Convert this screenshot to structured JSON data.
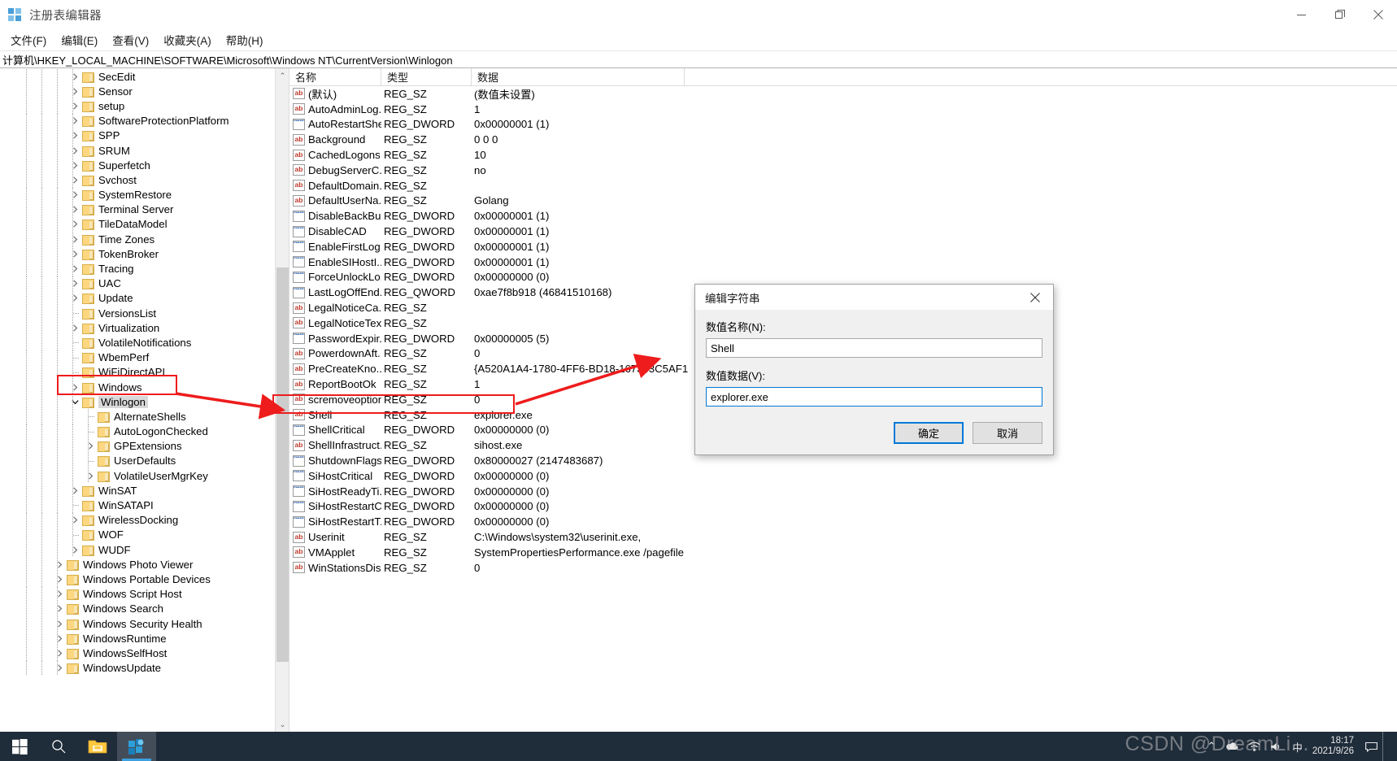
{
  "window": {
    "title": "注册表编辑器",
    "minimize_label": "—",
    "maximize_label": "❐",
    "close_label": "✕"
  },
  "menu": {
    "items": [
      {
        "label": "文件(F)"
      },
      {
        "label": "编辑(E)"
      },
      {
        "label": "查看(V)"
      },
      {
        "label": "收藏夹(A)"
      },
      {
        "label": "帮助(H)"
      }
    ]
  },
  "address": {
    "path": "计算机\\HKEY_LOCAL_MACHINE\\SOFTWARE\\Microsoft\\Windows NT\\CurrentVersion\\Winlogon"
  },
  "tree": {
    "scroll_up_icon": "⌃",
    "scroll_down_icon": "⌄",
    "nodes": [
      {
        "label": "SecEdit",
        "depth": 4,
        "expandable": true,
        "expanded": false,
        "selected": false
      },
      {
        "label": "Sensor",
        "depth": 4,
        "expandable": true,
        "expanded": false,
        "selected": false
      },
      {
        "label": "setup",
        "depth": 4,
        "expandable": true,
        "expanded": false,
        "selected": false
      },
      {
        "label": "SoftwareProtectionPlatform",
        "depth": 4,
        "expandable": true,
        "expanded": false,
        "selected": false
      },
      {
        "label": "SPP",
        "depth": 4,
        "expandable": true,
        "expanded": false,
        "selected": false
      },
      {
        "label": "SRUM",
        "depth": 4,
        "expandable": true,
        "expanded": false,
        "selected": false
      },
      {
        "label": "Superfetch",
        "depth": 4,
        "expandable": true,
        "expanded": false,
        "selected": false
      },
      {
        "label": "Svchost",
        "depth": 4,
        "expandable": true,
        "expanded": false,
        "selected": false
      },
      {
        "label": "SystemRestore",
        "depth": 4,
        "expandable": true,
        "expanded": false,
        "selected": false
      },
      {
        "label": "Terminal Server",
        "depth": 4,
        "expandable": true,
        "expanded": false,
        "selected": false
      },
      {
        "label": "TileDataModel",
        "depth": 4,
        "expandable": true,
        "expanded": false,
        "selected": false
      },
      {
        "label": "Time Zones",
        "depth": 4,
        "expandable": true,
        "expanded": false,
        "selected": false
      },
      {
        "label": "TokenBroker",
        "depth": 4,
        "expandable": true,
        "expanded": false,
        "selected": false
      },
      {
        "label": "Tracing",
        "depth": 4,
        "expandable": true,
        "expanded": false,
        "selected": false
      },
      {
        "label": "UAC",
        "depth": 4,
        "expandable": true,
        "expanded": false,
        "selected": false
      },
      {
        "label": "Update",
        "depth": 4,
        "expandable": true,
        "expanded": false,
        "selected": false
      },
      {
        "label": "VersionsList",
        "depth": 4,
        "expandable": false,
        "expanded": false,
        "selected": false
      },
      {
        "label": "Virtualization",
        "depth": 4,
        "expandable": true,
        "expanded": false,
        "selected": false
      },
      {
        "label": "VolatileNotifications",
        "depth": 4,
        "expandable": false,
        "expanded": false,
        "selected": false
      },
      {
        "label": "WbemPerf",
        "depth": 4,
        "expandable": false,
        "expanded": false,
        "selected": false
      },
      {
        "label": "WiFiDirectAPI",
        "depth": 4,
        "expandable": false,
        "expanded": false,
        "selected": false
      },
      {
        "label": "Windows",
        "depth": 4,
        "expandable": true,
        "expanded": false,
        "selected": false
      },
      {
        "label": "Winlogon",
        "depth": 4,
        "expandable": true,
        "expanded": true,
        "selected": true
      },
      {
        "label": "AlternateShells",
        "depth": 5,
        "expandable": false,
        "expanded": false,
        "selected": false
      },
      {
        "label": "AutoLogonChecked",
        "depth": 5,
        "expandable": false,
        "expanded": false,
        "selected": false
      },
      {
        "label": "GPExtensions",
        "depth": 5,
        "expandable": true,
        "expanded": false,
        "selected": false
      },
      {
        "label": "UserDefaults",
        "depth": 5,
        "expandable": false,
        "expanded": false,
        "selected": false
      },
      {
        "label": "VolatileUserMgrKey",
        "depth": 5,
        "expandable": true,
        "expanded": false,
        "selected": false
      },
      {
        "label": "WinSAT",
        "depth": 4,
        "expandable": true,
        "expanded": false,
        "selected": false
      },
      {
        "label": "WinSATAPI",
        "depth": 4,
        "expandable": false,
        "expanded": false,
        "selected": false
      },
      {
        "label": "WirelessDocking",
        "depth": 4,
        "expandable": true,
        "expanded": false,
        "selected": false
      },
      {
        "label": "WOF",
        "depth": 4,
        "expandable": false,
        "expanded": false,
        "selected": false
      },
      {
        "label": "WUDF",
        "depth": 4,
        "expandable": true,
        "expanded": false,
        "selected": false
      },
      {
        "label": "Windows Photo Viewer",
        "depth": 3,
        "expandable": true,
        "expanded": false,
        "selected": false
      },
      {
        "label": "Windows Portable Devices",
        "depth": 3,
        "expandable": true,
        "expanded": false,
        "selected": false
      },
      {
        "label": "Windows Script Host",
        "depth": 3,
        "expandable": true,
        "expanded": false,
        "selected": false
      },
      {
        "label": "Windows Search",
        "depth": 3,
        "expandable": true,
        "expanded": false,
        "selected": false
      },
      {
        "label": "Windows Security Health",
        "depth": 3,
        "expandable": true,
        "expanded": false,
        "selected": false
      },
      {
        "label": "WindowsRuntime",
        "depth": 3,
        "expandable": true,
        "expanded": false,
        "selected": false
      },
      {
        "label": "WindowsSelfHost",
        "depth": 3,
        "expandable": true,
        "expanded": false,
        "selected": false
      },
      {
        "label": "WindowsUpdate",
        "depth": 3,
        "expandable": true,
        "expanded": false,
        "selected": false
      }
    ]
  },
  "values": {
    "columns": {
      "name": "名称",
      "type": "类型",
      "data": "数据"
    },
    "rows": [
      {
        "icon": "string-value-icon",
        "name": "(默认)",
        "type": "REG_SZ",
        "data": "(数值未设置)",
        "highlight": false
      },
      {
        "icon": "string-value-icon",
        "name": "AutoAdminLog...",
        "type": "REG_SZ",
        "data": "1",
        "highlight": false
      },
      {
        "icon": "dword-value-icon",
        "name": "AutoRestartShell",
        "type": "REG_DWORD",
        "data": "0x00000001 (1)",
        "highlight": false
      },
      {
        "icon": "string-value-icon",
        "name": "Background",
        "type": "REG_SZ",
        "data": "0 0 0",
        "highlight": false
      },
      {
        "icon": "string-value-icon",
        "name": "CachedLogons...",
        "type": "REG_SZ",
        "data": "10",
        "highlight": false
      },
      {
        "icon": "string-value-icon",
        "name": "DebugServerC...",
        "type": "REG_SZ",
        "data": "no",
        "highlight": false
      },
      {
        "icon": "string-value-icon",
        "name": "DefaultDomain...",
        "type": "REG_SZ",
        "data": "",
        "highlight": false
      },
      {
        "icon": "string-value-icon",
        "name": "DefaultUserNa...",
        "type": "REG_SZ",
        "data": "Golang",
        "highlight": false
      },
      {
        "icon": "dword-value-icon",
        "name": "DisableBackBu...",
        "type": "REG_DWORD",
        "data": "0x00000001 (1)",
        "highlight": false
      },
      {
        "icon": "dword-value-icon",
        "name": "DisableCAD",
        "type": "REG_DWORD",
        "data": "0x00000001 (1)",
        "highlight": false
      },
      {
        "icon": "dword-value-icon",
        "name": "EnableFirstLog...",
        "type": "REG_DWORD",
        "data": "0x00000001 (1)",
        "highlight": false
      },
      {
        "icon": "dword-value-icon",
        "name": "EnableSIHostI...",
        "type": "REG_DWORD",
        "data": "0x00000001 (1)",
        "highlight": false
      },
      {
        "icon": "dword-value-icon",
        "name": "ForceUnlockLo...",
        "type": "REG_DWORD",
        "data": "0x00000000 (0)",
        "highlight": false
      },
      {
        "icon": "dword-value-icon",
        "name": "LastLogOffEnd...",
        "type": "REG_QWORD",
        "data": "0xae7f8b918 (46841510168)",
        "highlight": false
      },
      {
        "icon": "string-value-icon",
        "name": "LegalNoticeCa...",
        "type": "REG_SZ",
        "data": "",
        "highlight": false
      },
      {
        "icon": "string-value-icon",
        "name": "LegalNoticeText",
        "type": "REG_SZ",
        "data": "",
        "highlight": false
      },
      {
        "icon": "dword-value-icon",
        "name": "PasswordExpir...",
        "type": "REG_DWORD",
        "data": "0x00000005 (5)",
        "highlight": false
      },
      {
        "icon": "string-value-icon",
        "name": "PowerdownAft...",
        "type": "REG_SZ",
        "data": "0",
        "highlight": false
      },
      {
        "icon": "string-value-icon",
        "name": "PreCreateKno...",
        "type": "REG_SZ",
        "data": "{A520A1A4-1780-4FF6-BD18-167343C5AF1",
        "highlight": false
      },
      {
        "icon": "string-value-icon",
        "name": "ReportBootOk",
        "type": "REG_SZ",
        "data": "1",
        "highlight": false
      },
      {
        "icon": "string-value-icon",
        "name": "scremoveoption",
        "type": "REG_SZ",
        "data": "0",
        "highlight": false
      },
      {
        "icon": "string-value-icon",
        "name": "Shell",
        "type": "REG_SZ",
        "data": "explorer.exe",
        "highlight": true
      },
      {
        "icon": "dword-value-icon",
        "name": "ShellCritical",
        "type": "REG_DWORD",
        "data": "0x00000000 (0)",
        "highlight": false
      },
      {
        "icon": "string-value-icon",
        "name": "ShellInfrastruct...",
        "type": "REG_SZ",
        "data": "sihost.exe",
        "highlight": false
      },
      {
        "icon": "dword-value-icon",
        "name": "ShutdownFlags",
        "type": "REG_DWORD",
        "data": "0x80000027 (2147483687)",
        "highlight": false
      },
      {
        "icon": "dword-value-icon",
        "name": "SiHostCritical",
        "type": "REG_DWORD",
        "data": "0x00000000 (0)",
        "highlight": false
      },
      {
        "icon": "dword-value-icon",
        "name": "SiHostReadyTi...",
        "type": "REG_DWORD",
        "data": "0x00000000 (0)",
        "highlight": false
      },
      {
        "icon": "dword-value-icon",
        "name": "SiHostRestartC...",
        "type": "REG_DWORD",
        "data": "0x00000000 (0)",
        "highlight": false
      },
      {
        "icon": "dword-value-icon",
        "name": "SiHostRestartT...",
        "type": "REG_DWORD",
        "data": "0x00000000 (0)",
        "highlight": false
      },
      {
        "icon": "string-value-icon",
        "name": "Userinit",
        "type": "REG_SZ",
        "data": "C:\\Windows\\system32\\userinit.exe,",
        "highlight": false
      },
      {
        "icon": "string-value-icon",
        "name": "VMApplet",
        "type": "REG_SZ",
        "data": "SystemPropertiesPerformance.exe /pagefile",
        "highlight": false
      },
      {
        "icon": "string-value-icon",
        "name": "WinStationsDis...",
        "type": "REG_SZ",
        "data": "0",
        "highlight": false
      }
    ]
  },
  "dialog": {
    "title": "编辑字符串",
    "close_label": "✕",
    "name_label": "数值名称(N):",
    "name_value": "Shell",
    "data_label": "数值数据(V):",
    "data_value": "explorer.exe",
    "ok_label": "确定",
    "cancel_label": "取消"
  },
  "taskbar": {
    "start_name": "start-button",
    "search_name": "search-button",
    "explorer_name": "file-explorer-button",
    "regedit_name": "registry-editor-button",
    "tray_expand": "⌃",
    "ime_label": "中",
    "time": "18:17",
    "date": "2021/9/26"
  },
  "watermark": {
    "text": "CSDN @DreamLi..."
  },
  "colors": {
    "accent": "#0078d7",
    "annotation": "#ee1c1c",
    "folder": "#fcd77f",
    "taskbar": "#1f2c3a"
  }
}
